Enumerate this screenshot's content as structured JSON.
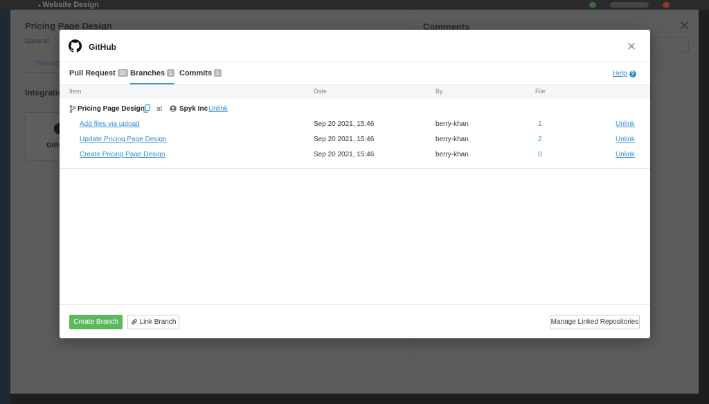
{
  "background": {
    "breadcrumb": "Website Design",
    "title": "Pricing Page Design",
    "subtitle": "Game of",
    "tab": "Summa",
    "section": "Integratio",
    "card_label": "Gith",
    "comments_title": "Comments"
  },
  "modal": {
    "title": "GitHub",
    "close": "✕",
    "help": "Help",
    "help_icon": "?",
    "tabs": [
      {
        "label": "Pull Request",
        "count": "20"
      },
      {
        "label": "Branches",
        "count": "1"
      },
      {
        "label": "Commits",
        "count": "5"
      }
    ],
    "columns": {
      "item": "Item",
      "date": "Date",
      "by": "By",
      "file": "File"
    },
    "branch": {
      "name": "Pricing Page Design",
      "at": "at",
      "org": "Spyk Inc",
      "unlink": "Unlink"
    },
    "commits": [
      {
        "item": "Add files via upload",
        "date": "Sep 20 2021, 15:46",
        "by": "berry-khan",
        "file": "1",
        "action": "Unlink"
      },
      {
        "item": "Update Pricing Page Design",
        "date": "Sep 20 2021, 15:46",
        "by": "berry-khan",
        "file": "2",
        "action": "Unlink"
      },
      {
        "item": "Create Pricing Page Design",
        "date": "Sep 20 2021, 15:46",
        "by": "berry-khan",
        "file": "0",
        "action": "Unlink"
      }
    ],
    "footer": {
      "create_branch": "Create Branch",
      "link_branch": "Link Branch",
      "manage_repos": "Manage Linked Repositories"
    }
  },
  "colors": {
    "accent": "#3a96d4",
    "link": "#2f8fd3",
    "create_button": "#5cb85c"
  }
}
